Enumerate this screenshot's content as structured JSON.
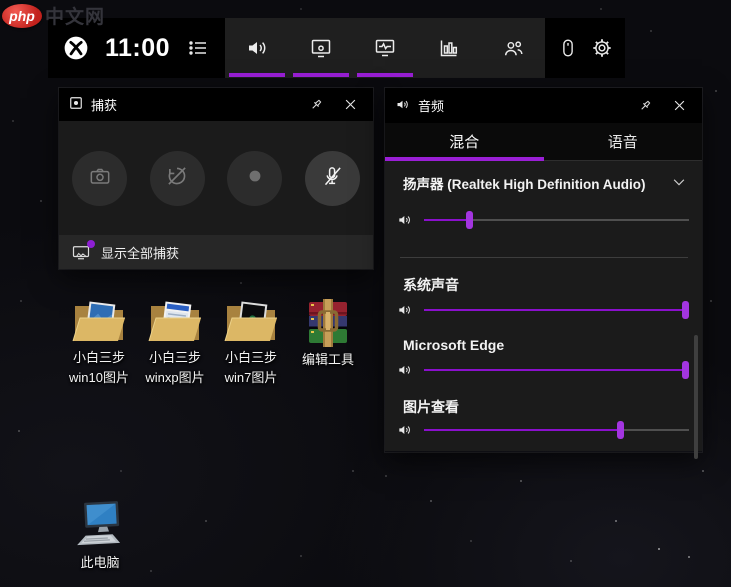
{
  "watermark": {
    "logo": "php",
    "site": "中文网"
  },
  "topbar": {
    "time": "11:00",
    "left_icons": [
      {
        "name": "xbox-logo"
      },
      {
        "name": "widget-menu-icon"
      }
    ],
    "widgets": [
      {
        "name": "audio",
        "icon": "speaker-icon",
        "active": true
      },
      {
        "name": "capture",
        "icon": "capture-icon",
        "active": true
      },
      {
        "name": "broadcast",
        "icon": "broadcast-icon",
        "active": true
      },
      {
        "name": "performance",
        "icon": "performance-icon",
        "active": false
      },
      {
        "name": "social",
        "icon": "people-icon",
        "active": false
      }
    ],
    "right_icons": [
      {
        "name": "mouse-icon"
      },
      {
        "name": "settings-gear-icon"
      }
    ]
  },
  "capture_panel": {
    "title": "捕获",
    "buttons": [
      {
        "icon": "camera-icon",
        "enabled": false
      },
      {
        "icon": "record-last-icon",
        "enabled": false
      },
      {
        "icon": "record-icon",
        "enabled": false
      },
      {
        "icon": "mic-muted-icon",
        "enabled": true
      }
    ],
    "footer": "显示全部捕获"
  },
  "audio_panel": {
    "title": "音频",
    "tabs": [
      {
        "label": "混合",
        "active": true
      },
      {
        "label": "语音",
        "active": false
      }
    ],
    "device": "扬声器 (Realtek High Definition Audio)",
    "sliders": [
      {
        "label": "",
        "value": 17
      },
      {
        "label": "系统声音",
        "value": 100
      },
      {
        "label": "Microsoft Edge",
        "value": 100
      },
      {
        "label": "图片查看",
        "value": 74
      }
    ]
  },
  "desktop": {
    "icons": [
      {
        "type": "folder-win10",
        "line1": "小白三步",
        "line2": "win10图片"
      },
      {
        "type": "folder-winxp",
        "line1": "小白三步",
        "line2": "winxp图片"
      },
      {
        "type": "folder-win7",
        "line1": "小白三步",
        "line2": "win7图片"
      },
      {
        "type": "winrar",
        "line1": "编辑工具",
        "line2": ""
      },
      {
        "type": "this-pc",
        "line1": "此电脑",
        "line2": ""
      }
    ]
  },
  "colors": {
    "accent": "#9a1fd6",
    "panel_bg": "#1b1b1b",
    "titlebar_bg": "#000000"
  }
}
